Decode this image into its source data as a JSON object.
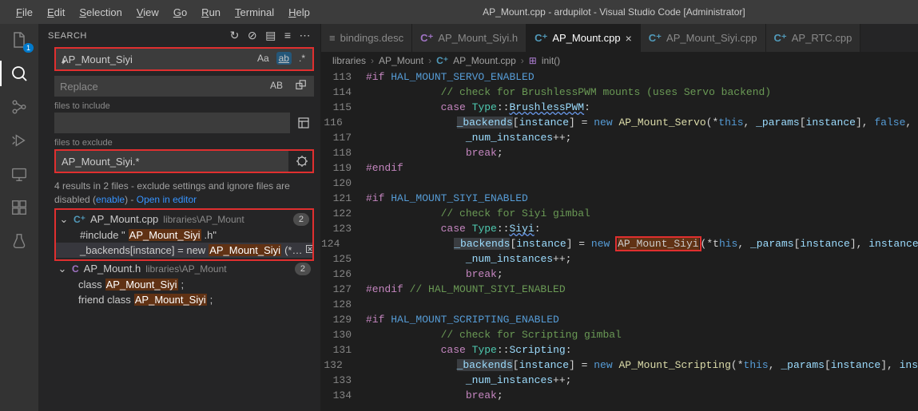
{
  "window": {
    "title": "AP_Mount.cpp - ardupilot - Visual Studio Code [Administrator]"
  },
  "menu": [
    "File",
    "Edit",
    "Selection",
    "View",
    "Go",
    "Run",
    "Terminal",
    "Help"
  ],
  "activity": {
    "explorer_badge": "1"
  },
  "search": {
    "panel_title": "SEARCH",
    "query": "AP_Mount_Siyi",
    "replace_placeholder": "Replace",
    "include_label": "files to include",
    "include_value": "",
    "exclude_label": "files to exclude",
    "exclude_value": "AP_Mount_Siyi.*",
    "summary_a": "4 results in 2 files - exclude settings and ignore files are disabled (",
    "summary_enable": "enable",
    "summary_b": ") - ",
    "summary_open": "Open in editor",
    "files": [
      {
        "name": "AP_Mount.cpp",
        "path": "libraries\\AP_Mount",
        "count": "2",
        "matches": [
          {
            "pre": "#include \"",
            "hl": "AP_Mount_Siyi",
            "post": ".h\""
          },
          {
            "pre": "_backends[instance] = new ",
            "hl": "AP_Mount_Siyi",
            "post": "(*…"
          }
        ]
      },
      {
        "name": "AP_Mount.h",
        "path": "libraries\\AP_Mount",
        "count": "2",
        "matches": [
          {
            "pre": "class ",
            "hl": "AP_Mount_Siyi",
            "post": ";"
          },
          {
            "pre": "friend class ",
            "hl": "AP_Mount_Siyi",
            "post": ";"
          }
        ]
      }
    ]
  },
  "tabs": [
    {
      "icon": "≡",
      "label": "bindings.desc",
      "icon_color": "#8a8a8a"
    },
    {
      "icon": "C⁺",
      "label": "AP_Mount_Siyi.h",
      "icon_color": "#a074c4"
    },
    {
      "icon": "C⁺",
      "label": "AP_Mount.cpp",
      "icon_color": "#519aba",
      "active": true,
      "close": "×"
    },
    {
      "icon": "C⁺",
      "label": "AP_Mount_Siyi.cpp",
      "icon_color": "#519aba"
    },
    {
      "icon": "C⁺",
      "label": "AP_RTC.cpp",
      "icon_color": "#519aba"
    }
  ],
  "crumbs": {
    "a": "libraries",
    "b": "AP_Mount",
    "c": "AP_Mount.cpp",
    "d": "init()"
  },
  "code": [
    [
      113,
      [
        [
          "pp",
          "#if "
        ],
        [
          "mac",
          "HAL_MOUNT_SERVO_ENABLED"
        ]
      ]
    ],
    [
      114,
      [
        [
          "sp",
          "            "
        ],
        [
          "com",
          "// check for BrushlessPWM mounts (uses Servo backend)"
        ]
      ]
    ],
    [
      115,
      [
        [
          "sp",
          "            "
        ],
        [
          "kw",
          "case "
        ],
        [
          "type",
          "Type"
        ],
        [
          "op",
          "::"
        ],
        [
          "var_w",
          "BrushlessPWM"
        ],
        [
          "op",
          ":"
        ]
      ]
    ],
    [
      116,
      [
        [
          "sp",
          "                "
        ],
        [
          "bk",
          "_backends"
        ],
        [
          "op",
          "["
        ],
        [
          "var",
          "instance"
        ],
        [
          "op",
          "] = "
        ],
        [
          "kw2",
          "new"
        ],
        [
          "op",
          " "
        ],
        [
          "fn",
          "AP_Mount_Servo"
        ],
        [
          "op",
          "(*"
        ],
        [
          "kw2",
          "this"
        ],
        [
          "op",
          ", "
        ],
        [
          "var",
          "_params"
        ],
        [
          "op",
          "["
        ],
        [
          "var",
          "instance"
        ],
        [
          "op",
          "], "
        ],
        [
          "kw2",
          "false"
        ],
        [
          "op",
          ", "
        ]
      ]
    ],
    [
      117,
      [
        [
          "sp",
          "                "
        ],
        [
          "var",
          "_num_instances"
        ],
        [
          "op",
          "++;"
        ]
      ]
    ],
    [
      118,
      [
        [
          "sp",
          "                "
        ],
        [
          "kw",
          "break"
        ],
        [
          "op",
          ";"
        ]
      ]
    ],
    [
      119,
      [
        [
          "pp",
          "#endif"
        ]
      ]
    ],
    [
      120,
      []
    ],
    [
      121,
      [
        [
          "pp",
          "#if "
        ],
        [
          "mac",
          "HAL_MOUNT_SIYI_ENABLED"
        ]
      ]
    ],
    [
      122,
      [
        [
          "sp",
          "            "
        ],
        [
          "com",
          "// check for Siyi gimbal"
        ]
      ]
    ],
    [
      123,
      [
        [
          "sp",
          "            "
        ],
        [
          "kw",
          "case "
        ],
        [
          "type",
          "Type"
        ],
        [
          "op",
          "::"
        ],
        [
          "var_w",
          "Siyi"
        ],
        [
          "op",
          ":"
        ]
      ]
    ],
    [
      124,
      [
        [
          "sp",
          "                "
        ],
        [
          "bk",
          "_backends"
        ],
        [
          "op",
          "["
        ],
        [
          "var",
          "instance"
        ],
        [
          "op",
          "] = "
        ],
        [
          "kw2",
          "new"
        ],
        [
          "op",
          " "
        ],
        [
          "red_start",
          ""
        ],
        [
          "sel",
          "AP_Mount_Siyi"
        ],
        [
          "red_end",
          ""
        ],
        [
          "op",
          "(*t"
        ],
        [
          "kw2_sub",
          "his"
        ],
        [
          "op",
          ", "
        ],
        [
          "var",
          "_params"
        ],
        [
          "op",
          "["
        ],
        [
          "var",
          "instance"
        ],
        [
          "op",
          "], "
        ],
        [
          "var",
          "instance"
        ]
      ]
    ],
    [
      125,
      [
        [
          "sp",
          "                "
        ],
        [
          "var",
          "_num_instances"
        ],
        [
          "op",
          "++;"
        ]
      ]
    ],
    [
      126,
      [
        [
          "sp",
          "                "
        ],
        [
          "kw",
          "break"
        ],
        [
          "op",
          ";"
        ]
      ]
    ],
    [
      127,
      [
        [
          "pp",
          "#endif "
        ],
        [
          "com",
          "// HAL_MOUNT_SIYI_ENABLED"
        ]
      ]
    ],
    [
      128,
      []
    ],
    [
      129,
      [
        [
          "pp",
          "#if "
        ],
        [
          "mac",
          "HAL_MOUNT_SCRIPTING_ENABLED"
        ]
      ]
    ],
    [
      130,
      [
        [
          "sp",
          "            "
        ],
        [
          "com",
          "// check for Scripting gimbal"
        ]
      ]
    ],
    [
      131,
      [
        [
          "sp",
          "            "
        ],
        [
          "kw",
          "case "
        ],
        [
          "type",
          "Type"
        ],
        [
          "op",
          "::"
        ],
        [
          "var",
          "Scripting"
        ],
        [
          "op",
          ":"
        ]
      ]
    ],
    [
      132,
      [
        [
          "sp",
          "                "
        ],
        [
          "bk",
          "_backends"
        ],
        [
          "op",
          "["
        ],
        [
          "var",
          "instance"
        ],
        [
          "op",
          "] = "
        ],
        [
          "kw2",
          "new"
        ],
        [
          "op",
          " "
        ],
        [
          "fn",
          "AP_Mount_Scripting"
        ],
        [
          "op",
          "(*"
        ],
        [
          "kw2",
          "this"
        ],
        [
          "op",
          ", "
        ],
        [
          "var",
          "_params"
        ],
        [
          "op",
          "["
        ],
        [
          "var",
          "instance"
        ],
        [
          "op",
          "], "
        ],
        [
          "var",
          "ins"
        ]
      ]
    ],
    [
      133,
      [
        [
          "sp",
          "                "
        ],
        [
          "var",
          "_num_instances"
        ],
        [
          "op",
          "++;"
        ]
      ]
    ],
    [
      134,
      [
        [
          "sp",
          "                "
        ],
        [
          "kw",
          "break"
        ],
        [
          "op",
          ";"
        ]
      ]
    ]
  ]
}
